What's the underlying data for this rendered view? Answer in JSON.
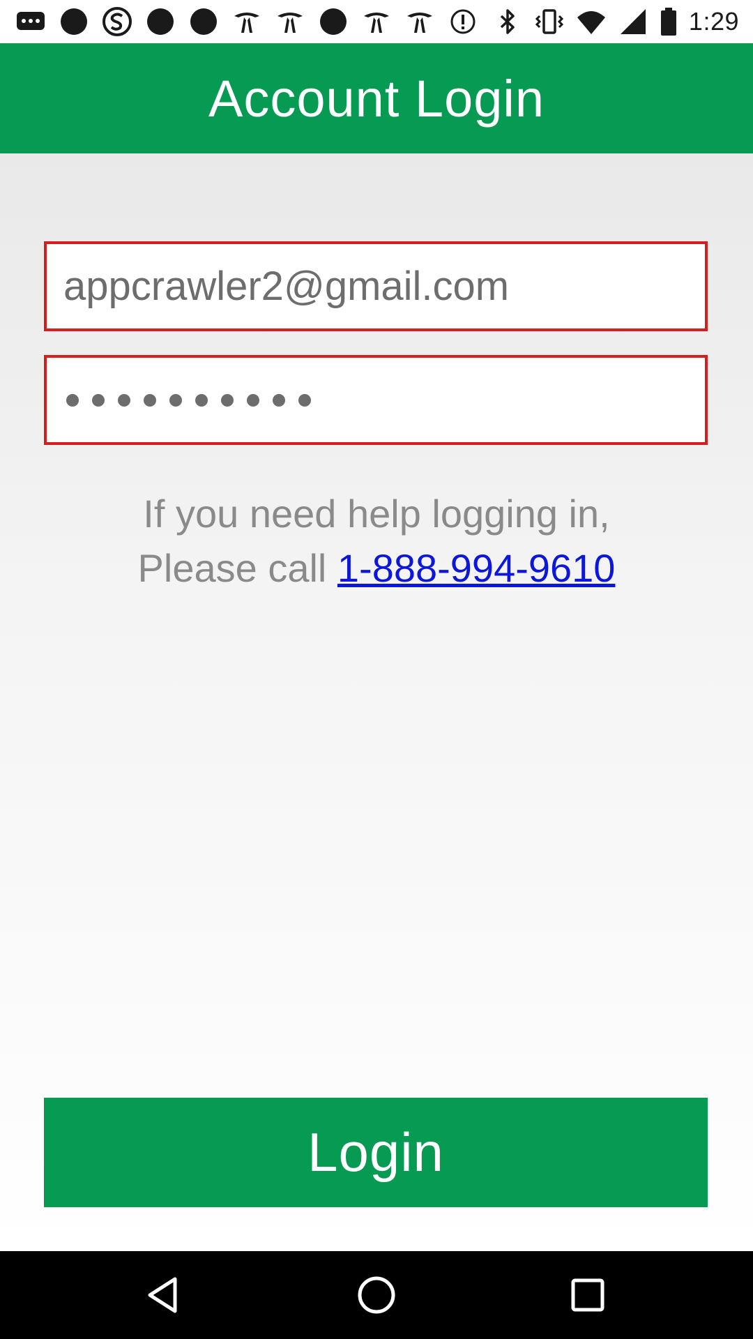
{
  "status_bar": {
    "time": "1:29",
    "left_icons": [
      "messages-icon",
      "circle-notification-icon",
      "s-app-icon",
      "circle-notification-icon",
      "circle-notification-icon",
      "tower-icon",
      "tower-icon",
      "circle-notification-icon",
      "tower-icon",
      "tower-icon",
      "info-icon"
    ],
    "right_icons": [
      "bluetooth-icon",
      "vibrate-icon",
      "wifi-icon",
      "signal-icon",
      "battery-icon"
    ]
  },
  "app_bar": {
    "title": "Account Login"
  },
  "login_form": {
    "email_value": "appcrawler2@gmail.com",
    "password_masked_count": 10
  },
  "help": {
    "line1": "If you need help logging in,",
    "line2_prefix": "Please call ",
    "phone": "1-888-994-9610"
  },
  "login_button": {
    "label": "Login"
  },
  "colors": {
    "brand_green": "#069a52",
    "error_red": "#d71e1e",
    "link_blue": "#0c17d9"
  },
  "nav_bar": {
    "icons": [
      "back-icon",
      "home-icon",
      "recents-icon"
    ]
  }
}
